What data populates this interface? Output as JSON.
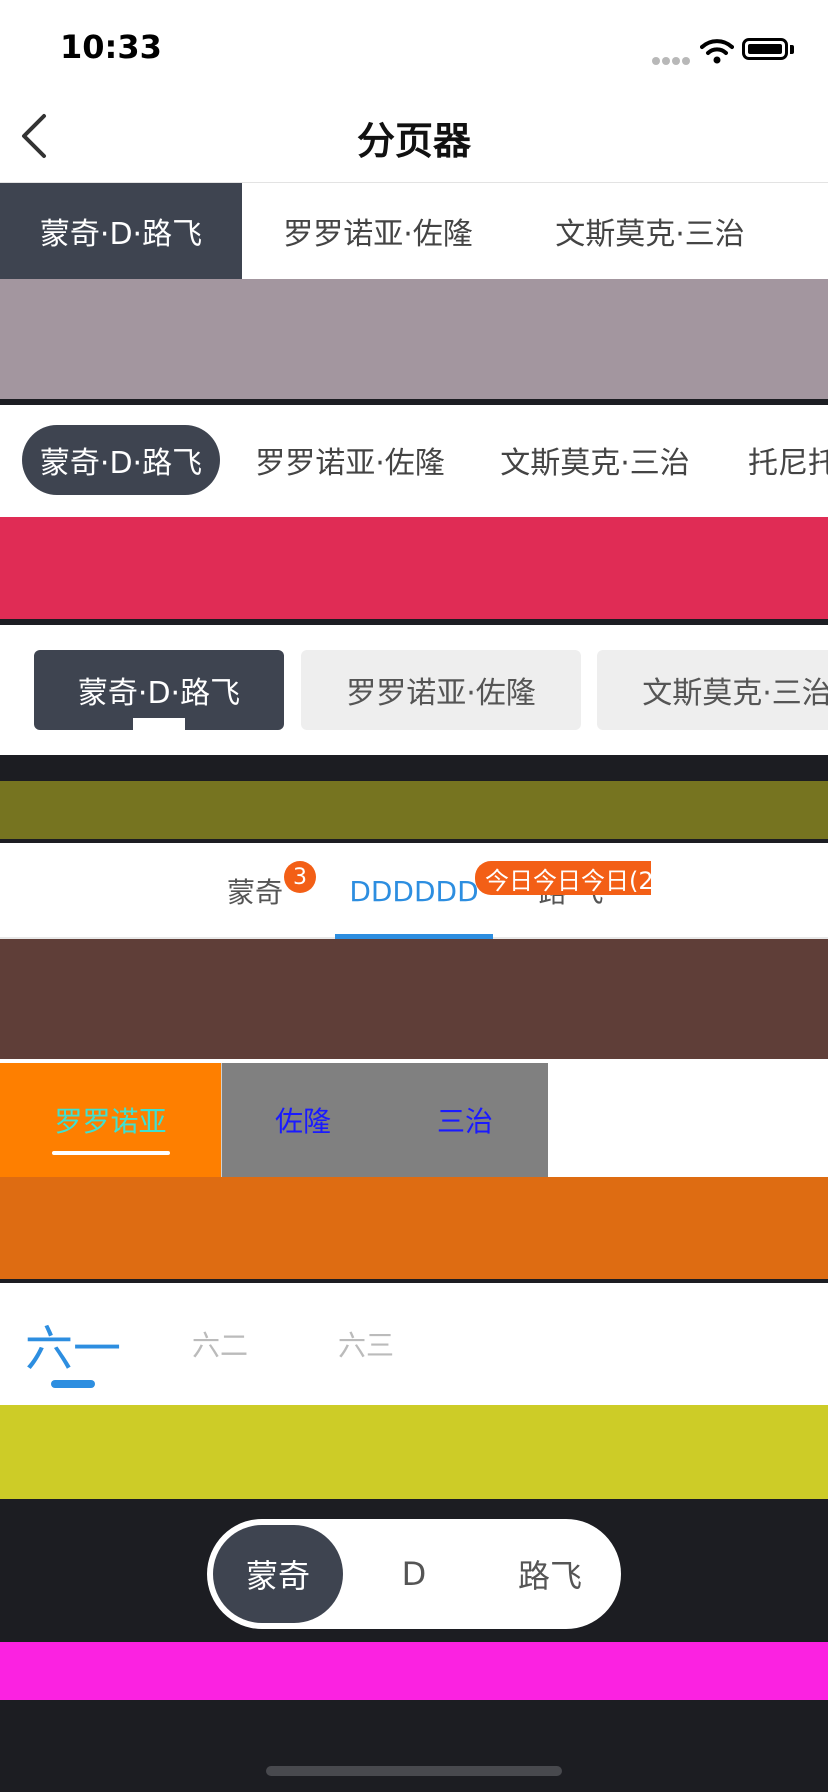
{
  "status_bar": {
    "time": "10:33"
  },
  "nav": {
    "title": "分页器"
  },
  "segment1": {
    "items": [
      "蒙奇·D·路飞",
      "罗罗诺亚·佐隆",
      "文斯莫克·三治"
    ]
  },
  "segment2": {
    "items": [
      "蒙奇·D·路飞",
      "罗罗诺亚·佐隆",
      "文斯莫克·三治",
      "托尼托"
    ]
  },
  "segment3": {
    "items": [
      "蒙奇·D·路飞",
      "罗罗诺亚·佐隆",
      "文斯莫克·三治"
    ]
  },
  "segment4": {
    "items": [
      "蒙奇",
      "DDDDDD",
      "路 飞"
    ],
    "badge_count": "3",
    "badge_text": "今日今日今日(2"
  },
  "segment5": {
    "items": [
      "罗罗诺亚",
      "佐隆",
      "三治"
    ]
  },
  "segment6": {
    "items": [
      "六一",
      "六二",
      "六三"
    ]
  },
  "segment7": {
    "items": [
      "蒙奇",
      "D",
      "路飞"
    ]
  },
  "colors": {
    "selected": "#3e4450",
    "accent_blue": "#2d8ee0",
    "badge_orange": "#f35f16",
    "band1": "#a3969f",
    "band2": "#e02c55",
    "band3": "#767420",
    "band4": "#5f3e38",
    "band5": "#de6c12",
    "band6": "#cdcc27",
    "band7": "#fb22e1"
  },
  "icons": [
    "back-chevron-icon",
    "cellular-signal-icon",
    "wifi-icon",
    "battery-icon"
  ]
}
